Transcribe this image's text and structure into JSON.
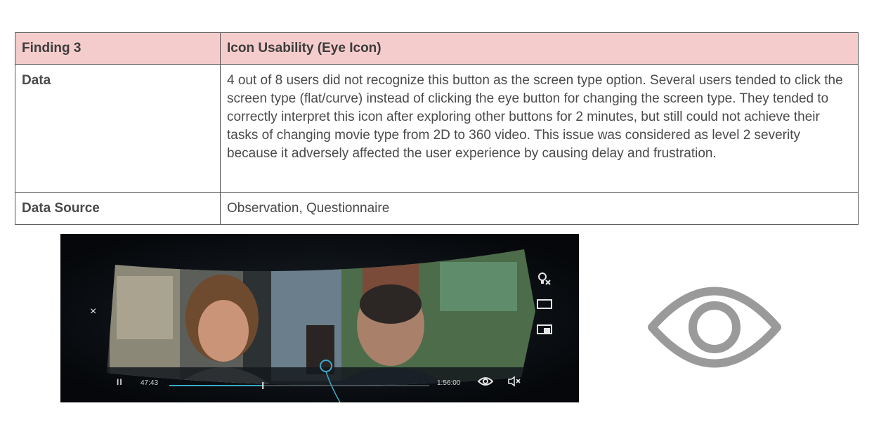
{
  "finding": {
    "title_label": "Finding 3",
    "title_value": "Icon Usability (Eye Icon)",
    "data_label": "Data",
    "data_text": "4 out of 8 users did not recognize this button as the screen type option. Several users tended to click the screen type (flat/curve) instead of clicking the eye button for changing the screen type. They tended to correctly interpret this icon after exploring other buttons for 2 minutes, but still could not achieve their tasks of changing movie type from 2D to 360 video. This issue was considered as level 2 severity because it adversely affected the user experience by causing delay and frustration.",
    "source_label": "Data Source",
    "source_text": "Observation, Questionnaire",
    "header_color": "#f5cccc"
  },
  "player": {
    "close_glyph": "×",
    "pause_glyph": "II",
    "time_current": "47:43",
    "time_total": "1:56:00",
    "progress": 0.36,
    "icons": [
      "close-icon",
      "lightbulb-off-icon",
      "flat-screen-icon",
      "curved-screen-icon",
      "pause-icon",
      "eye-icon",
      "mute-icon"
    ],
    "accent_color": "#3aa9c9"
  },
  "eye_icon": {
    "name": "eye-icon",
    "color": "#9a9a9a"
  }
}
